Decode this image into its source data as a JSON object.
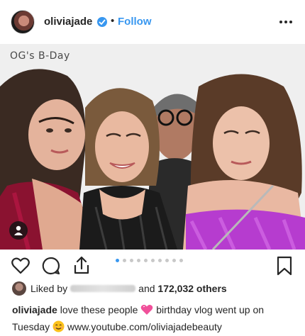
{
  "post": {
    "username": "oliviajade",
    "verified_icon": "verified-badge-icon",
    "separator": "•",
    "follow_label": "Follow",
    "photo_text": "OG's B-Day",
    "accent_color": "#3897f0"
  },
  "likes": {
    "prefix": "Liked by",
    "joiner": "and",
    "count": "172,032 others"
  },
  "caption": {
    "username": "oliviajade",
    "part1": "love these people",
    "part2": "birthday vlog went up on Tuesday",
    "link": "www.youtube.com/oliviajadebeauty"
  },
  "carousel": {
    "total": 10,
    "active_index": 0
  }
}
